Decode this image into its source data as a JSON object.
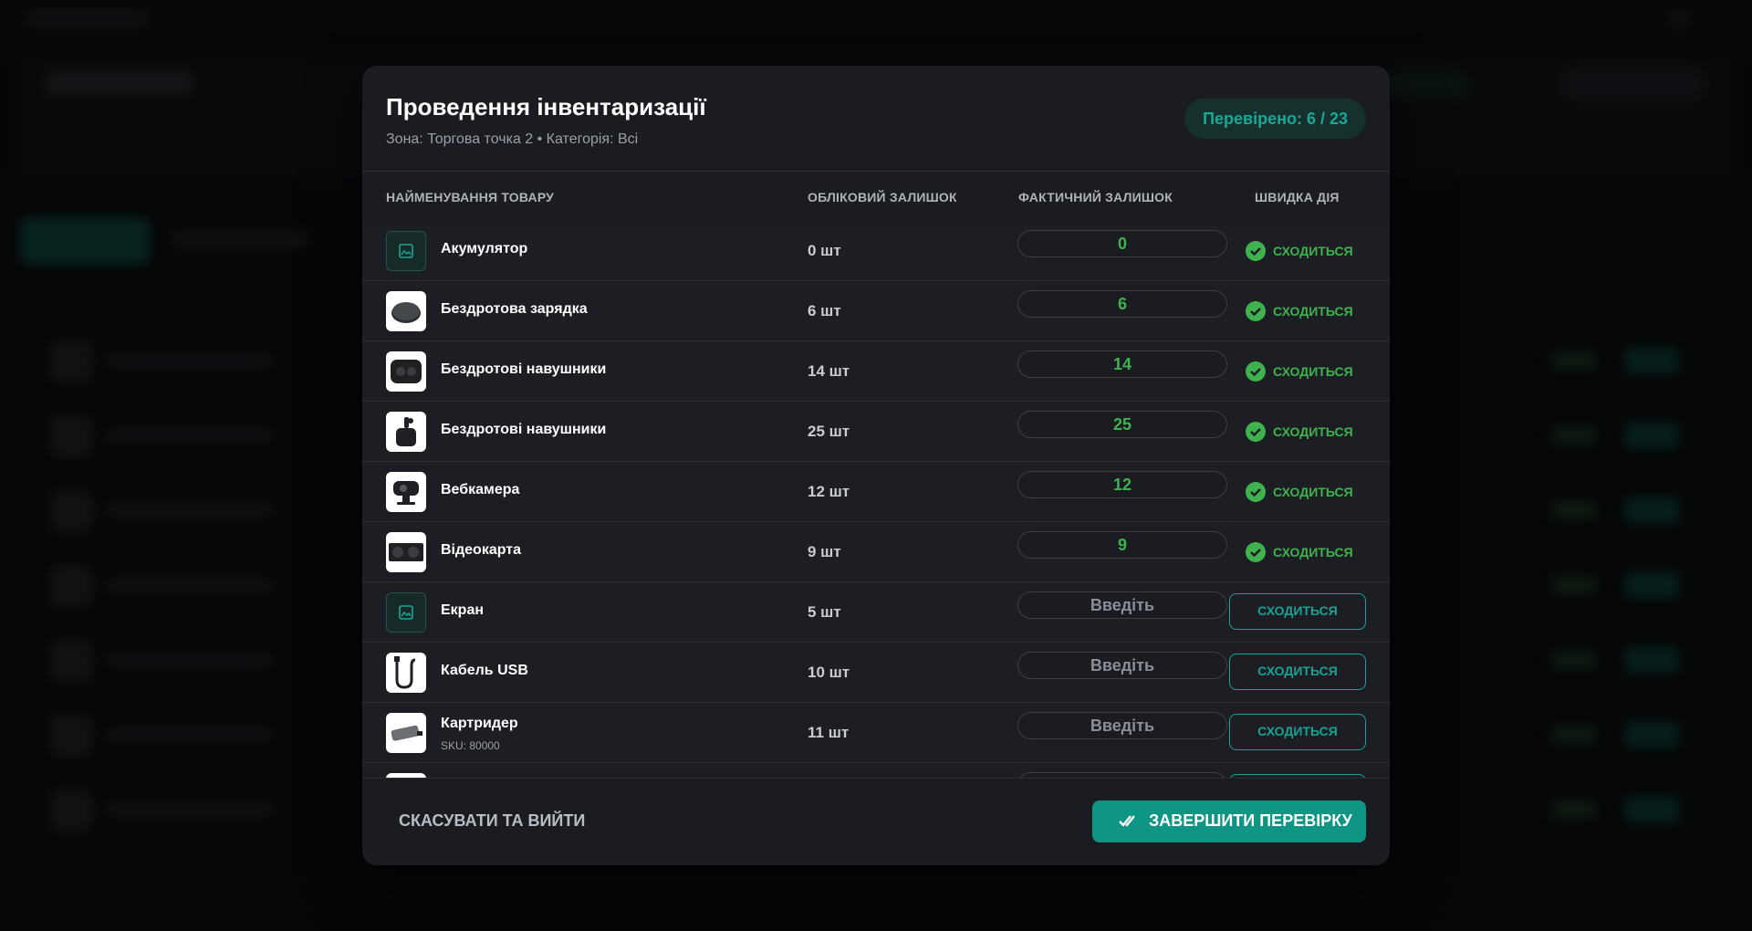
{
  "modal": {
    "title": "Проведення інвентаризації",
    "subtitle": "Зона: Торгова точка 2 • Категорія: Всі",
    "verified_badge": "Перевірено: 6 / 23",
    "accent_color": "#0f9584",
    "match_color": "#3fb24f"
  },
  "table": {
    "columns": {
      "name": "НАЙМЕНУВАННЯ ТОВАРУ",
      "book": "ОБЛІКОВИЙ ЗАЛИШОК",
      "actual": "ФАКТИЧНИЙ ЗАЛИШОК",
      "action": "ШВИДКА ДІЯ"
    },
    "qty_placeholder": "Введіть",
    "match_label": "СХОДИТЬСЯ",
    "match_button_label": "СХОДИТЬСЯ",
    "rows": [
      {
        "name": "Акумулятор",
        "stock": "0 шт",
        "actual": "0",
        "matched": true,
        "icon": "image-placeholder-icon"
      },
      {
        "name": "Бездротова зарядка",
        "stock": "6 шт",
        "actual": "6",
        "matched": true,
        "icon": "wireless-charger-icon"
      },
      {
        "name": "Бездротові навушники",
        "stock": "14 шт",
        "actual": "14",
        "matched": true,
        "icon": "earbuds-case-icon"
      },
      {
        "name": "Бездротові навушники",
        "stock": "25 шт",
        "actual": "25",
        "matched": true,
        "icon": "earbuds-icon"
      },
      {
        "name": "Вебкамера",
        "stock": "12 шт",
        "actual": "12",
        "matched": true,
        "icon": "webcam-icon"
      },
      {
        "name": "Відеокарта",
        "stock": "9 шт",
        "actual": "9",
        "matched": true,
        "icon": "graphics-card-icon"
      },
      {
        "name": "Екран",
        "stock": "5 шт",
        "actual": "",
        "matched": false,
        "icon": "image-placeholder-icon"
      },
      {
        "name": "Кабель USB",
        "stock": "10 шт",
        "actual": "",
        "matched": false,
        "icon": "usb-cable-icon"
      },
      {
        "name": "Картридер",
        "sku": "SKU: 80000",
        "stock": "11 шт",
        "actual": "",
        "matched": false,
        "icon": "card-reader-icon"
      }
    ]
  },
  "footer": {
    "cancel_label": "СКАСУВАТИ ТА ВИЙТИ",
    "finish_label": "ЗАВЕРШИТИ ПЕРЕВІРКУ"
  }
}
